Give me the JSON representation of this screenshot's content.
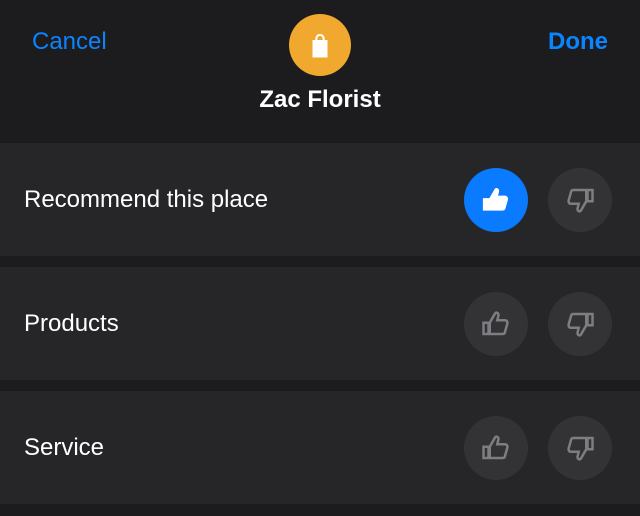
{
  "header": {
    "cancel_label": "Cancel",
    "done_label": "Done",
    "place_name": "Zac Florist",
    "icon": "shopping-bag"
  },
  "rows": [
    {
      "label": "Recommend this place",
      "thumbs_up_selected": true,
      "thumbs_down_selected": false
    },
    {
      "label": "Products",
      "thumbs_up_selected": false,
      "thumbs_down_selected": false
    },
    {
      "label": "Service",
      "thumbs_up_selected": false,
      "thumbs_down_selected": false
    }
  ]
}
